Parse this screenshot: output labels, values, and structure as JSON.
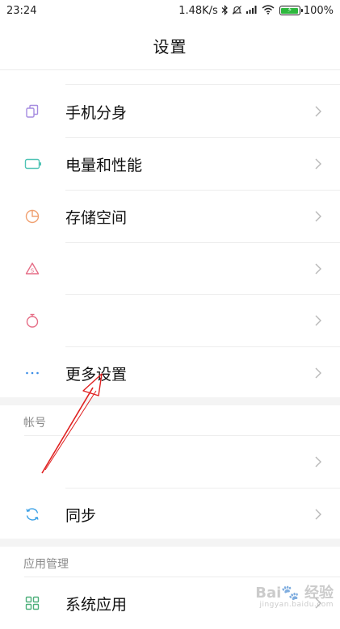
{
  "status_bar": {
    "time": "23:24",
    "speed": "1.48K/s",
    "battery_percent": "100%"
  },
  "header": {
    "title": "设置"
  },
  "settings_list": {
    "items": [
      {
        "label": "手机分身",
        "icon": "dual-apps-icon",
        "color": "#a58be0"
      },
      {
        "label": "电量和性能",
        "icon": "battery-icon",
        "color": "#4fc3b5"
      },
      {
        "label": "存储空间",
        "icon": "storage-pie-icon",
        "color": "#f0a070"
      },
      {
        "label": "",
        "icon": "warning-triangle-icon",
        "color": "#e56d86"
      },
      {
        "label": "",
        "icon": "timer-icon",
        "color": "#e56d86"
      },
      {
        "label": "更多设置",
        "icon": "more-dots-icon",
        "color": "#3d8ee6"
      }
    ]
  },
  "account_section": {
    "header": "帐号",
    "items": [
      {
        "label": "",
        "icon": ""
      },
      {
        "label": "同步",
        "icon": "sync-icon",
        "color": "#3aa0e6"
      }
    ]
  },
  "app_section": {
    "header": "应用管理",
    "items": [
      {
        "label": "系统应用",
        "icon": "grid-apps-icon",
        "color": "#4caf7a"
      }
    ]
  },
  "colors": {
    "annotation_arrow": "#e02020",
    "chevron": "#b8b8b8",
    "section_background": "#f4f4f4"
  }
}
